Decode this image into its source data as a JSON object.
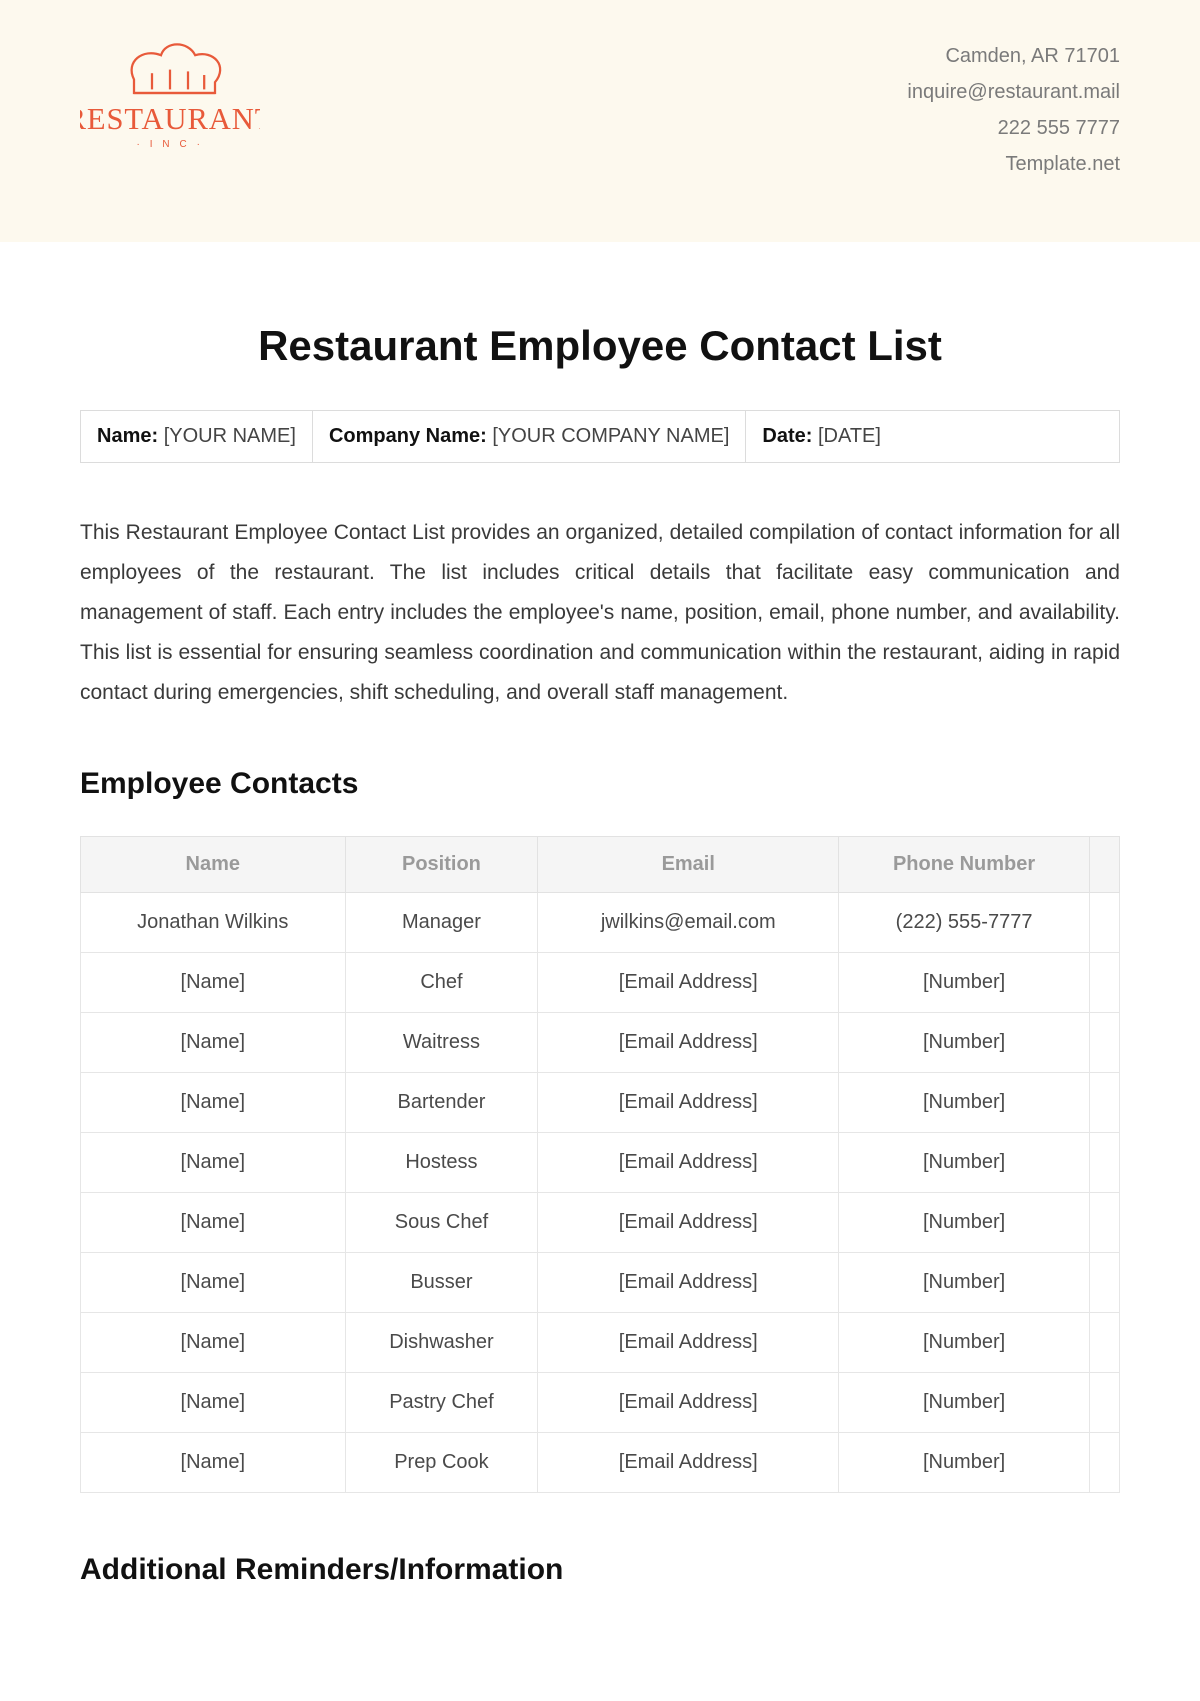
{
  "header": {
    "logo": {
      "main": "RESTAURANT",
      "sub": "· I N C ·"
    },
    "contact": {
      "address": "Camden, AR 71701",
      "email": "inquire@restaurant.mail",
      "phone": "222 555 7777",
      "site": "Template.net"
    }
  },
  "title": "Restaurant Employee Contact List",
  "info_bar": {
    "name_label": "Name:",
    "name_value": "[YOUR NAME]",
    "company_label": "Company Name:",
    "company_value": "[YOUR COMPANY NAME]",
    "date_label": "Date:",
    "date_value": "[DATE]"
  },
  "description": "This Restaurant Employee Contact List provides an organized, detailed compilation of contact information for all employees of the restaurant. The list includes critical details that facilitate easy communication and management of staff. Each entry includes the employee's name, position, email, phone number, and availability. This list is essential for ensuring seamless coordination and communication within the restaurant, aiding in rapid contact during emergencies, shift scheduling, and overall staff management.",
  "section1_heading": "Employee Contacts",
  "table": {
    "headers": {
      "name": "Name",
      "position": "Position",
      "email": "Email",
      "phone": "Phone Number"
    },
    "rows": [
      {
        "name": "Jonathan Wilkins",
        "position": "Manager",
        "email": "jwilkins@email.com",
        "phone": "(222) 555-7777"
      },
      {
        "name": "[Name]",
        "position": "Chef",
        "email": "[Email Address]",
        "phone": "[Number]"
      },
      {
        "name": "[Name]",
        "position": "Waitress",
        "email": "[Email Address]",
        "phone": "[Number]"
      },
      {
        "name": "[Name]",
        "position": "Bartender",
        "email": "[Email Address]",
        "phone": "[Number]"
      },
      {
        "name": "[Name]",
        "position": "Hostess",
        "email": "[Email Address]",
        "phone": "[Number]"
      },
      {
        "name": "[Name]",
        "position": "Sous Chef",
        "email": "[Email Address]",
        "phone": "[Number]"
      },
      {
        "name": "[Name]",
        "position": "Busser",
        "email": "[Email Address]",
        "phone": "[Number]"
      },
      {
        "name": "[Name]",
        "position": "Dishwasher",
        "email": "[Email Address]",
        "phone": "[Number]"
      },
      {
        "name": "[Name]",
        "position": "Pastry Chef",
        "email": "[Email Address]",
        "phone": "[Number]"
      },
      {
        "name": "[Name]",
        "position": "Prep Cook",
        "email": "[Email Address]",
        "phone": "[Number]"
      }
    ]
  },
  "section2_heading": "Additional Reminders/Information"
}
